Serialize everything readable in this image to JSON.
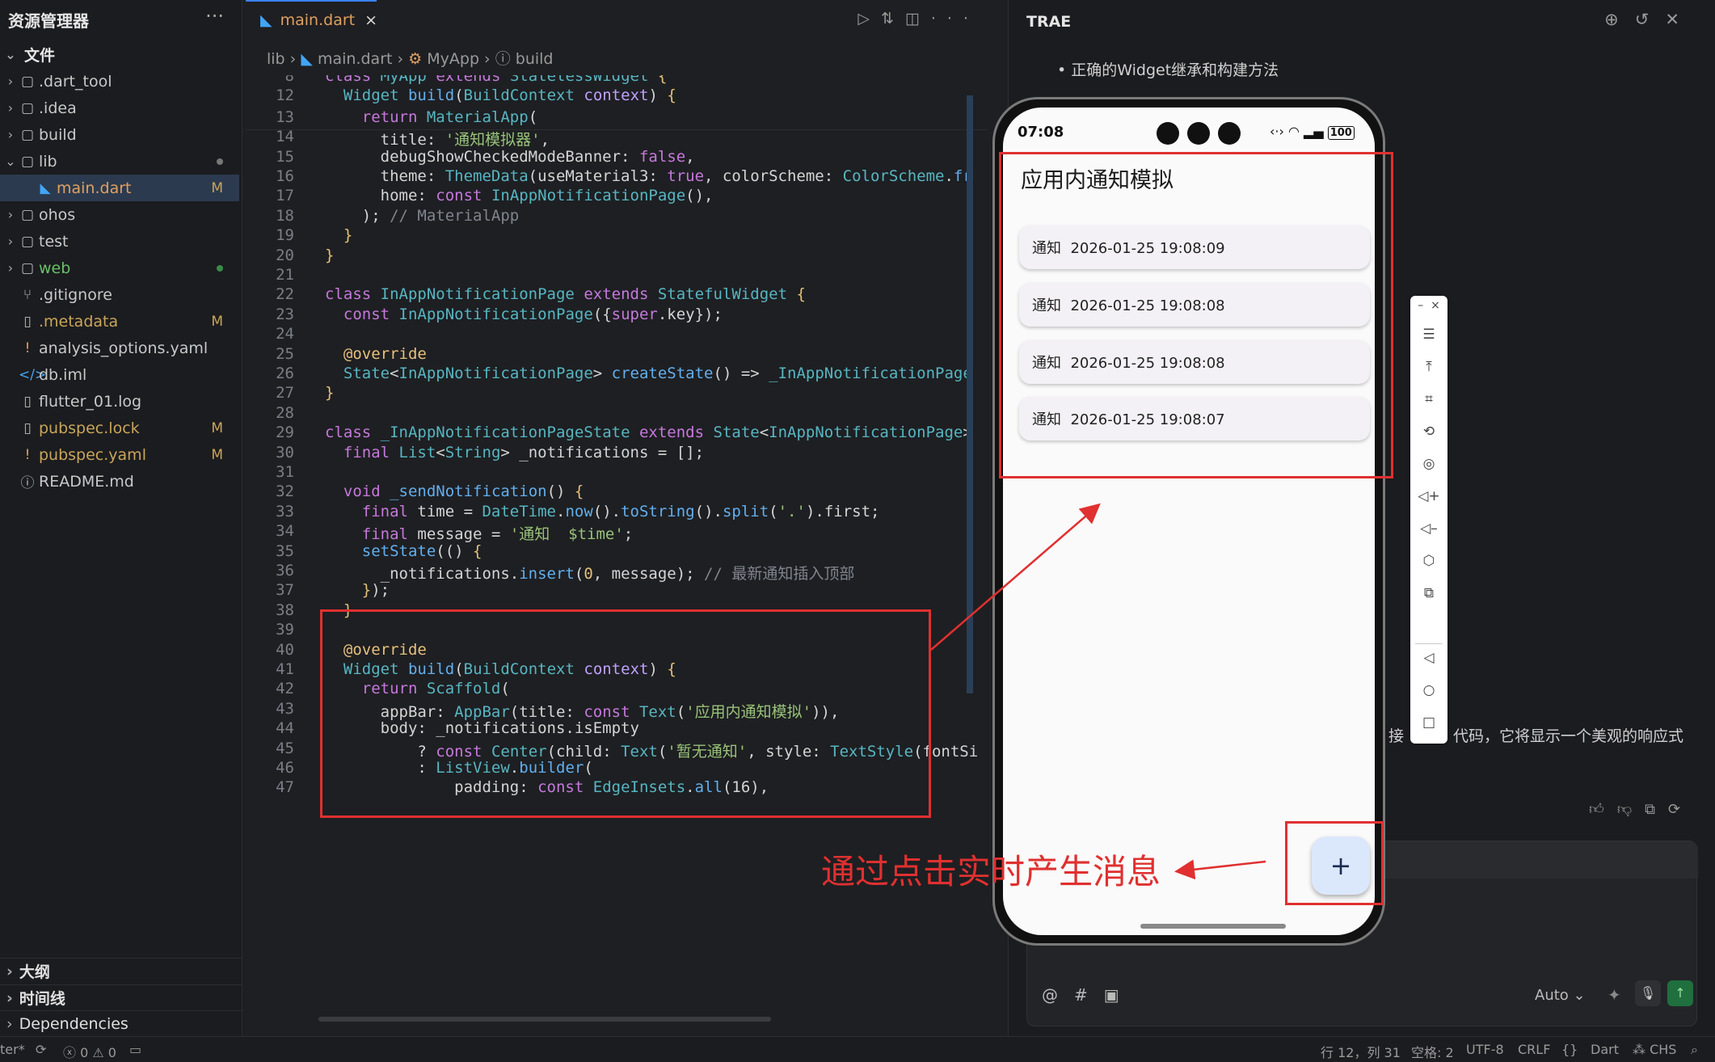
{
  "explorer": {
    "title": "资源管理器",
    "more": "···",
    "section": "文件",
    "items": [
      {
        "label": ".dart_tool",
        "type": "folder",
        "badge": ""
      },
      {
        "label": ".idea",
        "type": "folder",
        "badge": ""
      },
      {
        "label": "build",
        "type": "folder",
        "badge": ""
      },
      {
        "label": "lib",
        "type": "folder-open",
        "badge": ""
      },
      {
        "label": "main.dart",
        "type": "dart",
        "badge": "M"
      },
      {
        "label": "ohos",
        "type": "folder",
        "badge": ""
      },
      {
        "label": "test",
        "type": "folder",
        "badge": ""
      },
      {
        "label": "web",
        "type": "folder",
        "badge": ""
      },
      {
        "label": ".gitignore",
        "type": "git",
        "badge": ""
      },
      {
        "label": ".metadata",
        "type": "file",
        "badge": "M"
      },
      {
        "label": "analysis_options.yaml",
        "type": "yaml",
        "badge": ""
      },
      {
        "label": "db.iml",
        "type": "xml",
        "badge": ""
      },
      {
        "label": "flutter_01.log",
        "type": "file",
        "badge": ""
      },
      {
        "label": "pubspec.lock",
        "type": "file",
        "badge": "M"
      },
      {
        "label": "pubspec.yaml",
        "type": "yaml",
        "badge": "M"
      },
      {
        "label": "README.md",
        "type": "info",
        "badge": ""
      }
    ],
    "bottom_sections": [
      "大纲",
      "时间线",
      "Dependencies"
    ]
  },
  "editor": {
    "tab": "main.dart",
    "breadcrumb": [
      "lib",
      "main.dart",
      "MyApp",
      "build"
    ],
    "lines": [
      "8",
      "12",
      "13",
      "14",
      "15",
      "16",
      "17",
      "18",
      "19",
      "20",
      "21",
      "22",
      "23",
      "24",
      "25",
      "26",
      "27",
      "28",
      "29",
      "30",
      "31",
      "32",
      "33",
      "34",
      "35",
      "36",
      "37",
      "38",
      "39",
      "40",
      "41",
      "42",
      "43",
      "44",
      "45",
      "46",
      "47"
    ]
  },
  "trae": {
    "title": "TRAE",
    "bullet": "正确的Widget继承和构建方法",
    "partial_text": "接",
    "partial_text2": "代码，它将显示一个美观的响应式",
    "model": "Auto"
  },
  "phone": {
    "time": "07:08",
    "battery": "100",
    "app_title": "应用内通知模拟",
    "notifications": [
      "通知  2026-01-25 19:08:09",
      "通知  2026-01-25 19:08:08",
      "通知  2026-01-25 19:08:08",
      "通知  2026-01-25 19:08:07"
    ],
    "fab": "+"
  },
  "annotation": "通过点击实时产生消息",
  "status": {
    "left": "ter*",
    "errors": "0",
    "warnings": "0",
    "position": "行 12，列 31",
    "spaces": "空格: 2",
    "encoding": "UTF-8",
    "eol": "CRLF",
    "braces": "{}",
    "language": "Dart",
    "ime": "CHS"
  },
  "colors": {
    "accent": "#3b82f6",
    "annotation_red": "#e03030",
    "modified": "#c9a55a"
  }
}
